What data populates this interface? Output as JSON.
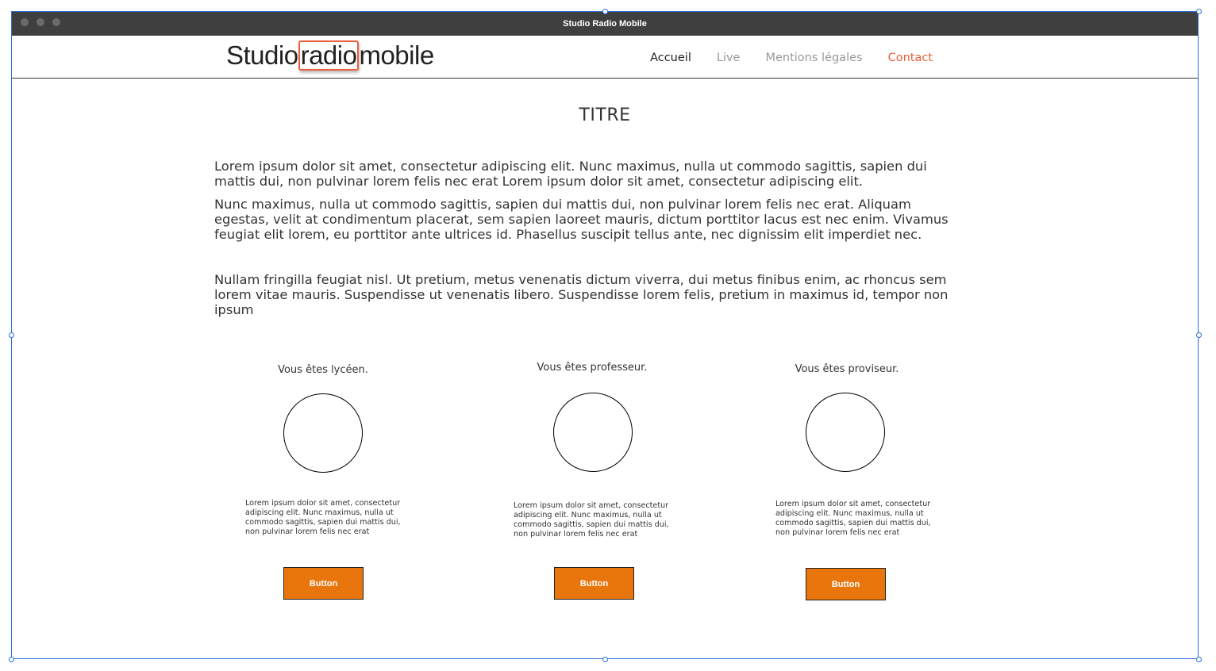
{
  "window": {
    "title": "Studio Radio Mobile"
  },
  "logo": {
    "part1": "Studio",
    "part2": "radio",
    "part3": "mobile"
  },
  "nav": [
    {
      "label": "Accueil"
    },
    {
      "label": "Live"
    },
    {
      "label": "Mentions légales"
    },
    {
      "label": "Contact"
    }
  ],
  "main": {
    "title": "TITRE",
    "paragraphs": [
      "Lorem ipsum dolor sit amet, consectetur adipiscing elit. Nunc maximus, nulla ut commodo sagittis, sapien dui mattis dui, non pulvinar lorem felis nec erat Lorem ipsum dolor sit amet, consectetur adipiscing elit.",
      "Nunc maximus, nulla ut commodo sagittis, sapien dui mattis dui, non pulvinar lorem felis nec erat. Aliquam egestas, velit at condimentum placerat, sem sapien laoreet mauris, dictum porttitor lacus est nec enim. Vivamus feugiat elit lorem, eu porttitor ante ultrices id. Phasellus suscipit tellus ante, nec dignissim elit imperdiet nec.",
      "Nullam fringilla feugiat nisl. Ut pretium, metus venenatis dictum viverra, dui metus finibus enim, ac rhoncus sem lorem vitae mauris. Suspendisse ut venenatis libero. Suspendisse lorem felis, pretium in maximus id, tempor non ipsum"
    ]
  },
  "columns": [
    {
      "role": "Vous êtes lycéen.",
      "text": "Lorem ipsum dolor sit amet, consectetur adipiscing elit. Nunc maximus, nulla ut commodo sagittis, sapien dui mattis dui, non pulvinar lorem felis nec erat",
      "button": "Button"
    },
    {
      "role": "Vous êtes professeur.",
      "text": "Lorem ipsum dolor sit amet, consectetur adipiscing elit. Nunc maximus, nulla ut commodo sagittis, sapien dui mattis dui, non pulvinar lorem felis nec erat",
      "button": "Button"
    },
    {
      "role": "Vous êtes proviseur.",
      "text": "Lorem ipsum dolor sit amet, consectetur adipiscing elit. Nunc maximus, nulla ut commodo sagittis, sapien dui mattis dui, non pulvinar lorem felis nec erat",
      "button": "Button"
    }
  ],
  "colors": {
    "accent": "#e8760c",
    "contact": "#e8603c",
    "selection": "#2b6fd6"
  }
}
